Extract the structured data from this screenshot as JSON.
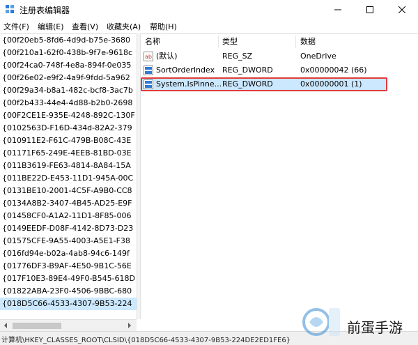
{
  "window": {
    "title": "注册表编辑器"
  },
  "menu": {
    "items": [
      "文件(F)",
      "编辑(E)",
      "查看(V)",
      "收藏夹(A)",
      "帮助(H)"
    ]
  },
  "tree": {
    "items": [
      "{00f20eb5-8fd6-4d9d-b75e-3680",
      "{00f210a1-62f0-438b-9f7e-9618c",
      "{00f24ca0-748f-4e8a-894f-0e035",
      "{00f26e02-e9f2-4a9f-9fdd-5a962",
      "{00f29a34-b8a1-482c-bcf8-3ac7b",
      "{00f2b433-44e4-4d88-b2b0-2698",
      "{00F2CE1E-935E-4248-892C-130F",
      "{0102563D-F16D-434d-82A2-379",
      "{010911E2-F61C-479B-B08C-43E",
      "{01171F65-249E-4EEB-81BD-03E",
      "{011B3619-FE63-4814-8A84-15A",
      "{011BE22D-E453-11D1-945A-00C",
      "{0131BE10-2001-4C5F-A9B0-CC8",
      "{0134A8B2-3407-4B45-AD25-E9F",
      "{01458CF0-A1A2-11D1-8F85-006",
      "{0149EEDF-D08F-4142-8D73-D23",
      "{01575CFE-9A55-4003-A5E1-F38",
      "{016fd94e-b02a-4ab8-94c6-149f",
      "{01776DF3-B9AF-4E50-9B1C-56E",
      "{017F10E3-89E4-49F0-B545-618D",
      "{01822ABA-23F0-4506-9BBC-680",
      "{018D5C66-4533-4307-9B53-224"
    ],
    "selected_index": 21
  },
  "list": {
    "headers": {
      "name": "名称",
      "type": "类型",
      "data": "数据"
    },
    "rows": [
      {
        "name": "(默认)",
        "type": "REG_SZ",
        "data": "OneDrive",
        "icon": "string-value-icon"
      },
      {
        "name": "SortOrderIndex",
        "type": "REG_DWORD",
        "data": "0x00000042 (66)",
        "icon": "binary-value-icon"
      },
      {
        "name": "System.IsPinne...",
        "type": "REG_DWORD",
        "data": "0x00000001 (1)",
        "icon": "binary-value-icon"
      }
    ],
    "selected_index": 2
  },
  "status": {
    "path": "计算机\\HKEY_CLASSES_ROOT\\CLSID\\{018D5C66-4533-4307-9B53-224DE2ED1FE6}"
  },
  "watermark": {
    "text": "前蛋手游"
  },
  "colors": {
    "selection": "#cce8ff",
    "highlight": "#e23b3b"
  }
}
